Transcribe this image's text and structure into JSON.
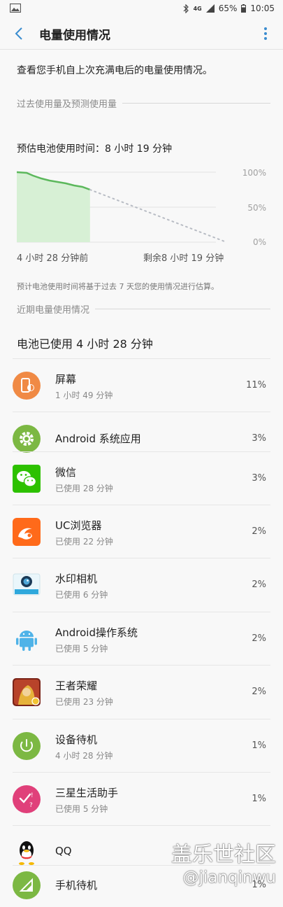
{
  "status": {
    "network": "4G",
    "battery": "65%",
    "time": "10:05"
  },
  "appbar": {
    "title": "电量使用情况"
  },
  "intro": "查看您手机自上次充满电后的电量使用情况。",
  "sections": {
    "past": "过去使用量及预测使用量",
    "recent": "近期电量使用情况"
  },
  "estimate": "预估电池使用时间：8 小时 19 分钟",
  "chart_data": {
    "type": "line",
    "series": [
      {
        "name": "",
        "points": [
          [
            0,
            100
          ],
          [
            0.6,
            99
          ],
          [
            1,
            95
          ],
          [
            1.5,
            91
          ],
          [
            2,
            88
          ],
          [
            2.5,
            86
          ],
          [
            3,
            84
          ],
          [
            3.5,
            81
          ],
          [
            4,
            79
          ],
          [
            4.47,
            75
          ]
        ]
      },
      {
        "name": "",
        "points": [
          [
            4.47,
            75
          ],
          [
            12.8,
            0
          ]
        ],
        "style": "dotted"
      }
    ],
    "y_ticks": [
      "100%",
      "50%",
      "0%"
    ],
    "x_labels": {
      "start": "4 小时 28 分钟前",
      "end": "剩余8 小时 19 分钟"
    },
    "xlim": [
      0,
      12.8
    ],
    "ylim": [
      0,
      100
    ],
    "colors": {
      "line": "#5cb85c",
      "fill": "#d7f0d5",
      "forecast": "#b8bcc4"
    }
  },
  "note": "预计电池使用时间将基于过去 7 天您的使用情况进行估算。",
  "used_title": "电池已使用 4 小时 28 分钟",
  "apps": [
    {
      "name": "屏幕",
      "sub": "1 小时 49 分钟",
      "pct": "11%",
      "icon": "screen-icon"
    },
    {
      "name": "Android 系统应用",
      "sub": "",
      "pct": "3%",
      "icon": "android-system-gear-icon"
    },
    {
      "name": "微信",
      "sub": "已使用 28 分钟",
      "pct": "3%",
      "icon": "wechat-icon"
    },
    {
      "name": "UC浏览器",
      "sub": "已使用 22 分钟",
      "pct": "2%",
      "icon": "uc-browser-icon"
    },
    {
      "name": "水印相机",
      "sub": "已使用 6 分钟",
      "pct": "2%",
      "icon": "watermark-camera-icon"
    },
    {
      "name": "Android操作系统",
      "sub": "已使用 5 分钟",
      "pct": "2%",
      "icon": "android-os-icon"
    },
    {
      "name": "王者荣耀",
      "sub": "已使用 23 分钟",
      "pct": "2%",
      "icon": "honor-of-kings-icon"
    },
    {
      "name": "设备待机",
      "sub": "4 小时 28 分钟",
      "pct": "1%",
      "icon": "standby-icon"
    },
    {
      "name": "三星生活助手",
      "sub": "已使用 5 分钟",
      "pct": "1%",
      "icon": "samsung-life-assistant-icon"
    },
    {
      "name": "QQ",
      "sub": "",
      "pct": "",
      "icon": "qq-icon"
    },
    {
      "name": "手机待机",
      "sub": "",
      "pct": "1%",
      "icon": "phone-standby-icon"
    }
  ],
  "watermark": {
    "line1": "盖乐世社区",
    "line2": "@jianqinwu"
  }
}
